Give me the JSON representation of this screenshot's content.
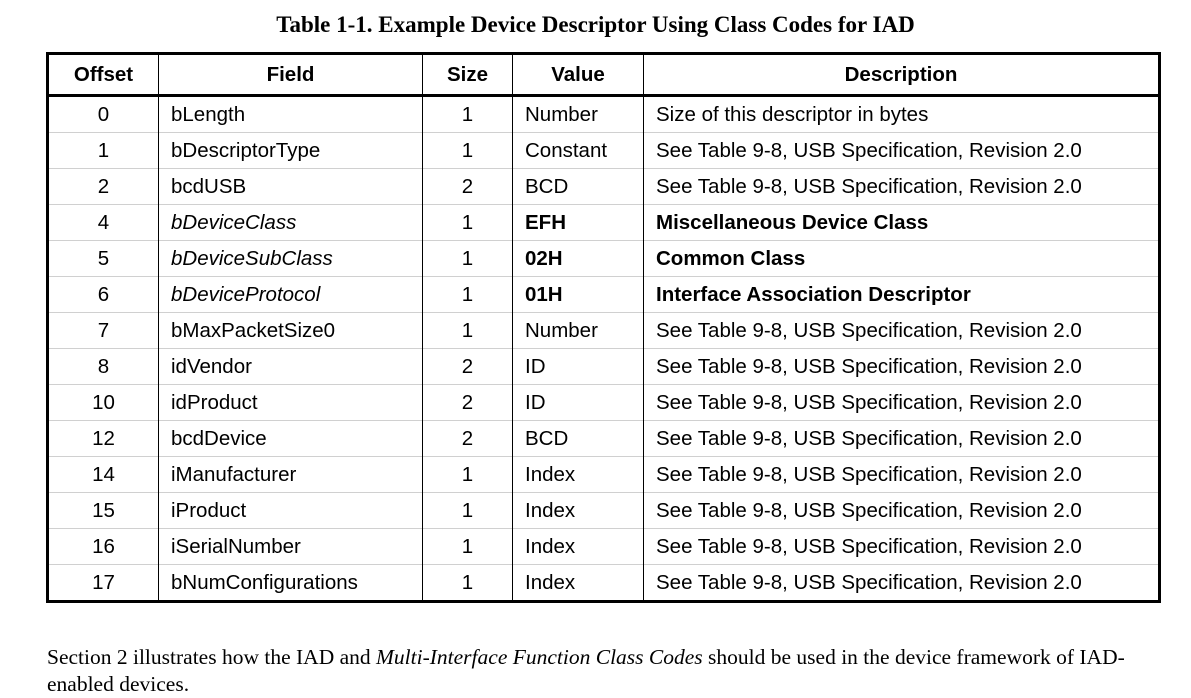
{
  "caption": "Table 1-1. Example Device Descriptor Using Class Codes for IAD",
  "table": {
    "headers": {
      "offset": "Offset",
      "field": "Field",
      "size": "Size",
      "value": "Value",
      "description": "Description"
    },
    "rows": [
      {
        "offset": "0",
        "field": "bLength",
        "size": "1",
        "value": "Number",
        "description": "Size of this descriptor in bytes"
      },
      {
        "offset": "1",
        "field": "bDescriptorType",
        "size": "1",
        "value": "Constant",
        "description": "See Table 9-8, USB Specification, Revision 2.0"
      },
      {
        "offset": "2",
        "field": "bcdUSB",
        "size": "2",
        "value": "BCD",
        "description": "See Table 9-8, USB Specification, Revision 2.0"
      },
      {
        "offset": "4",
        "field": "bDeviceClass",
        "size": "1",
        "value": "EFH",
        "description": "Miscellaneous Device Class"
      },
      {
        "offset": "5",
        "field": "bDeviceSubClass",
        "size": "1",
        "value": "02H",
        "description": "Common Class"
      },
      {
        "offset": "6",
        "field": "bDeviceProtocol",
        "size": "1",
        "value": "01H",
        "description": "Interface Association Descriptor"
      },
      {
        "offset": "7",
        "field": "bMaxPacketSize0",
        "size": "1",
        "value": "Number",
        "description": "See Table 9-8, USB Specification, Revision 2.0"
      },
      {
        "offset": "8",
        "field": "idVendor",
        "size": "2",
        "value": "ID",
        "description": "See Table 9-8, USB Specification, Revision 2.0"
      },
      {
        "offset": "10",
        "field": "idProduct",
        "size": "2",
        "value": "ID",
        "description": "See Table 9-8, USB Specification, Revision 2.0"
      },
      {
        "offset": "12",
        "field": "bcdDevice",
        "size": "2",
        "value": "BCD",
        "description": "See Table 9-8, USB Specification, Revision 2.0"
      },
      {
        "offset": "14",
        "field": "iManufacturer",
        "size": "1",
        "value": "Index",
        "description": "See Table 9-8, USB Specification, Revision 2.0"
      },
      {
        "offset": "15",
        "field": "iProduct",
        "size": "1",
        "value": "Index",
        "description": "See Table 9-8, USB Specification, Revision 2.0"
      },
      {
        "offset": "16",
        "field": "iSerialNumber",
        "size": "1",
        "value": "Index",
        "description": "See Table 9-8, USB Specification, Revision 2.0"
      },
      {
        "offset": "17",
        "field": "bNumConfigurations",
        "size": "1",
        "value": "Index",
        "description": "See Table 9-8, USB Specification, Revision 2.0"
      }
    ]
  },
  "paragraph": {
    "part1": "Section 2 illustrates how the IAD and ",
    "emphasis": "Multi-Interface Function Class Codes",
    "part2": " should be used in the device framework of IAD-enabled devices."
  }
}
